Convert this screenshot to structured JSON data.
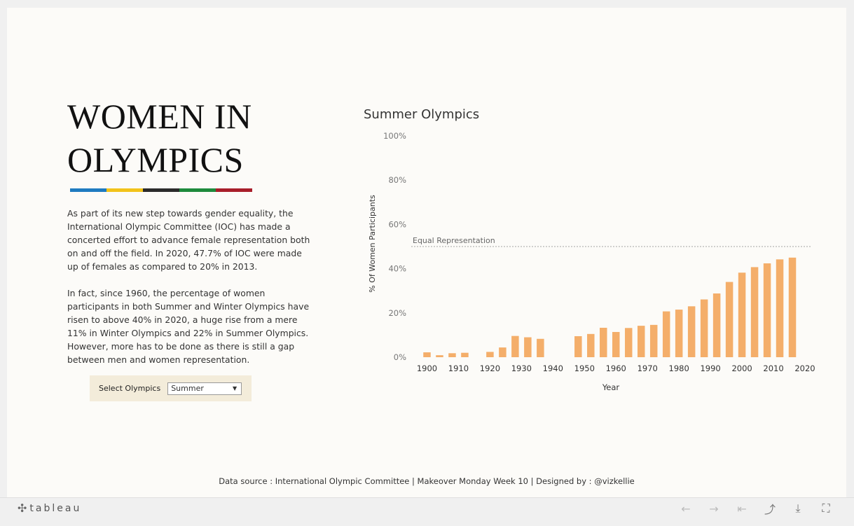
{
  "dashboard": {
    "title_line1": "WOMEN IN",
    "title_line2": "OLYMPICS",
    "ring_colors": [
      "#1f7bc0",
      "#f2c31a",
      "#2b2b2b",
      "#1e8a3c",
      "#a81e2a"
    ],
    "paragraph1": "As part of its new step towards gender equality, the International Olympic Committee (IOC) has made a concerted effort to advance female representation both on and off the field. In 2020, 47.7% of IOC were made up of females as compared to 20% in 2013.",
    "paragraph2": "In fact, since 1960, the percentage of women participants in both Summer and Winter Olympics have risen to above 40% in 2020, a huge rise from a mere 11% in Winter Olympics and 22% in Summer Olympics. However, more has to be done as there is still a gap between men and women representation.",
    "filter_label": "Select Olympics",
    "filter_value": "Summer",
    "footer": "Data source : International Olympic Committee | Makeover Monday Week 10 | Designed by : @vizkellie"
  },
  "chart_data": {
    "type": "bar",
    "title": "Summer Olympics",
    "xlabel": "Year",
    "ylabel": "% Of Women Participants",
    "xlim": [
      1895,
      2022
    ],
    "ylim": [
      0,
      100
    ],
    "y_ticks": [
      0,
      20,
      40,
      60,
      80,
      100
    ],
    "y_tick_labels": [
      "0%",
      "20%",
      "40%",
      "60%",
      "80%",
      "100%"
    ],
    "x_ticks": [
      1900,
      1910,
      1920,
      1930,
      1940,
      1950,
      1960,
      1970,
      1980,
      1990,
      2000,
      2010,
      2020
    ],
    "bar_color": "#f4ae6a",
    "reference_line": {
      "value": 50,
      "label": "Equal Representation"
    },
    "x": [
      1900,
      1904,
      1908,
      1912,
      1920,
      1924,
      1928,
      1932,
      1936,
      1948,
      1952,
      1956,
      1960,
      1964,
      1968,
      1972,
      1976,
      1980,
      1984,
      1988,
      1992,
      1996,
      2000,
      2004,
      2008,
      2012,
      2016
    ],
    "values": [
      2.2,
      0.9,
      1.8,
      2.0,
      2.4,
      4.4,
      9.6,
      9.0,
      8.3,
      9.5,
      10.5,
      13.3,
      11.4,
      13.2,
      14.2,
      14.6,
      20.7,
      21.5,
      23.0,
      26.1,
      28.8,
      34.0,
      38.2,
      40.7,
      42.4,
      44.2,
      45.0
    ]
  },
  "toolbar": {
    "brand": "tableau",
    "logo_icon": "✣",
    "undo_icon": "←",
    "redo_icon": "→",
    "revert_icon": "⇤",
    "share_icon": "⤴",
    "download_icon": "⤓",
    "fullscreen_icon": "⛶"
  }
}
